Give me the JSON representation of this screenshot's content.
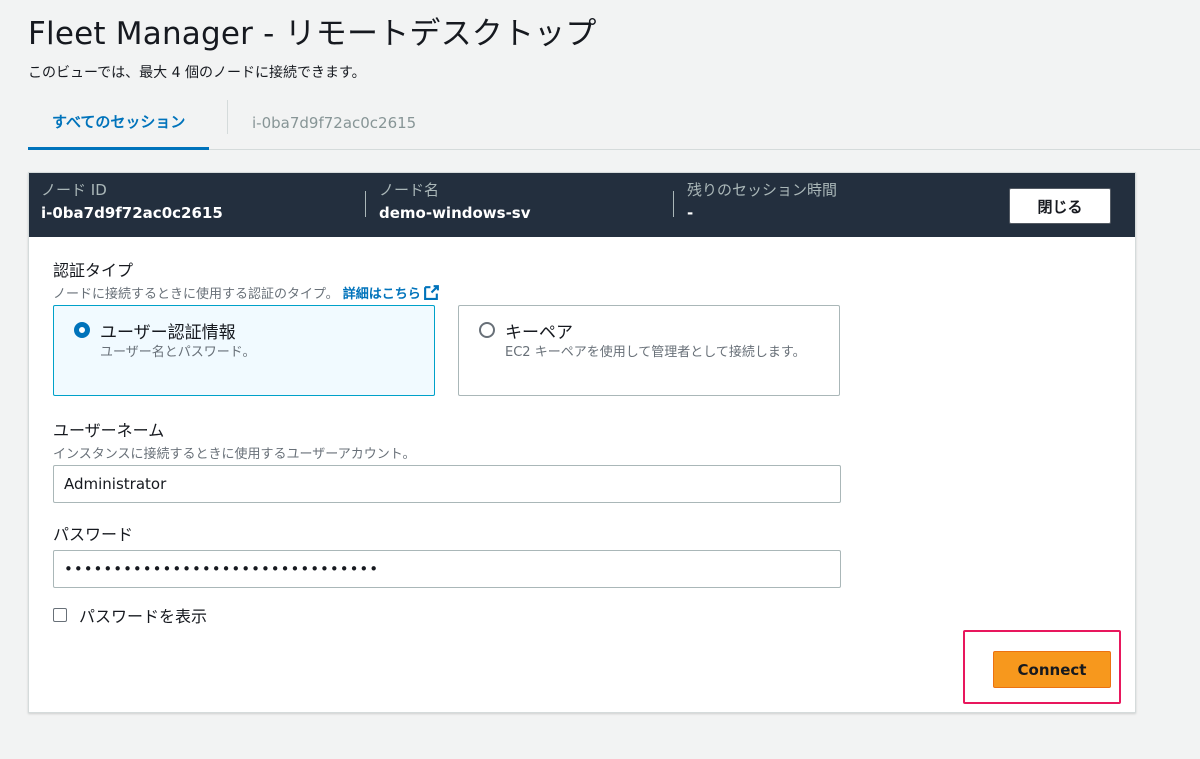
{
  "page": {
    "title": "Fleet Manager - リモートデスクトップ",
    "subtitle": "このビューでは、最大 4 個のノードに接続できます。"
  },
  "tabs": [
    {
      "label": "すべてのセッション",
      "active": true
    },
    {
      "label": "i-0ba7d9f72ac0c2615",
      "active": false
    }
  ],
  "session_header": {
    "node_id_label": "ノード ID",
    "node_id_value": "i-0ba7d9f72ac0c2615",
    "node_name_label": "ノード名",
    "node_name_value": "demo-windows-sv",
    "remaining_label": "残りのセッション時間",
    "remaining_value": "-",
    "close_label": "閉じる"
  },
  "auth": {
    "label": "認証タイプ",
    "description": "ノードに接続するときに使用する認証のタイプ。",
    "link_text": "詳細はこちら",
    "options": [
      {
        "title": "ユーザー認証情報",
        "description": "ユーザー名とパスワード。",
        "selected": true
      },
      {
        "title": "キーペア",
        "description": "EC2 キーペアを使用して管理者として接続します。",
        "selected": false
      }
    ]
  },
  "username": {
    "label": "ユーザーネーム",
    "description": "インスタンスに接続するときに使用するユーザーアカウント。",
    "value": "Administrator"
  },
  "password": {
    "label": "パスワード",
    "value": "••••••••••••••••••••••••••••••••"
  },
  "show_password_label": "パスワードを表示",
  "connect_label": "Connect",
  "colors": {
    "accent": "#0073bb",
    "header_bg": "#232f3e",
    "primary_button": "#f7981d",
    "highlight": "#e8175d"
  }
}
